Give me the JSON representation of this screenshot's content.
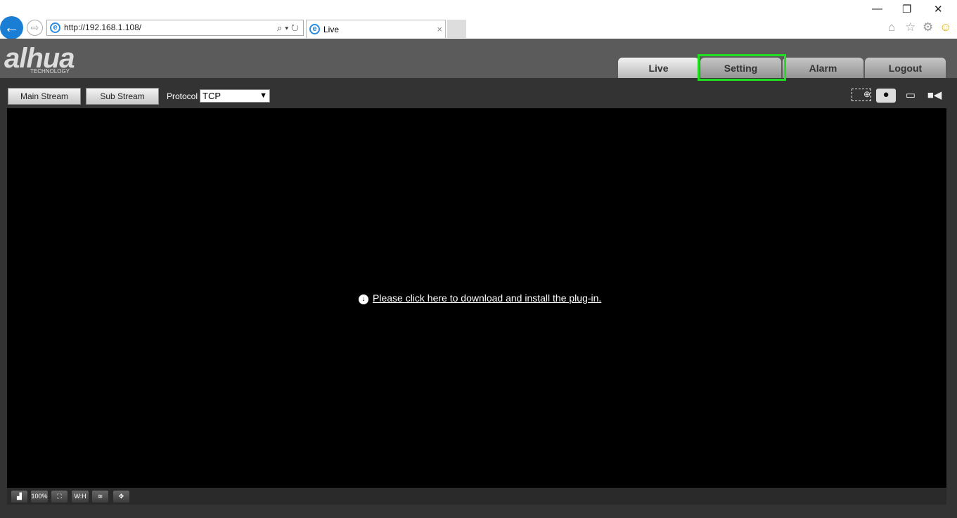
{
  "browser": {
    "url": "http://192.168.1.108/",
    "tab_title": "Live",
    "back": "←",
    "forward": "⇨",
    "search": "⌕ ▾",
    "refresh": "↻",
    "close_tab": "×",
    "minimize": "—",
    "restore": "❐",
    "close": "✕",
    "home": "⌂",
    "favorites": "☆",
    "tools": "⚙",
    "feedback": "☺"
  },
  "header": {
    "logo": "alhua",
    "logo_sub": "TECHNOLOGY",
    "tabs": [
      {
        "label": "Live"
      },
      {
        "label": "Setting"
      },
      {
        "label": "Alarm"
      },
      {
        "label": "Logout"
      }
    ]
  },
  "toolbar": {
    "main_stream": "Main Stream",
    "sub_stream": "Sub Stream",
    "protocol_label": "Protocol",
    "protocol_value": "TCP"
  },
  "video": {
    "plugin_text": "Please click here to download and install the plug-in."
  },
  "bottom": {
    "zoom_label": "100%",
    "ratio_label": "W:H"
  }
}
